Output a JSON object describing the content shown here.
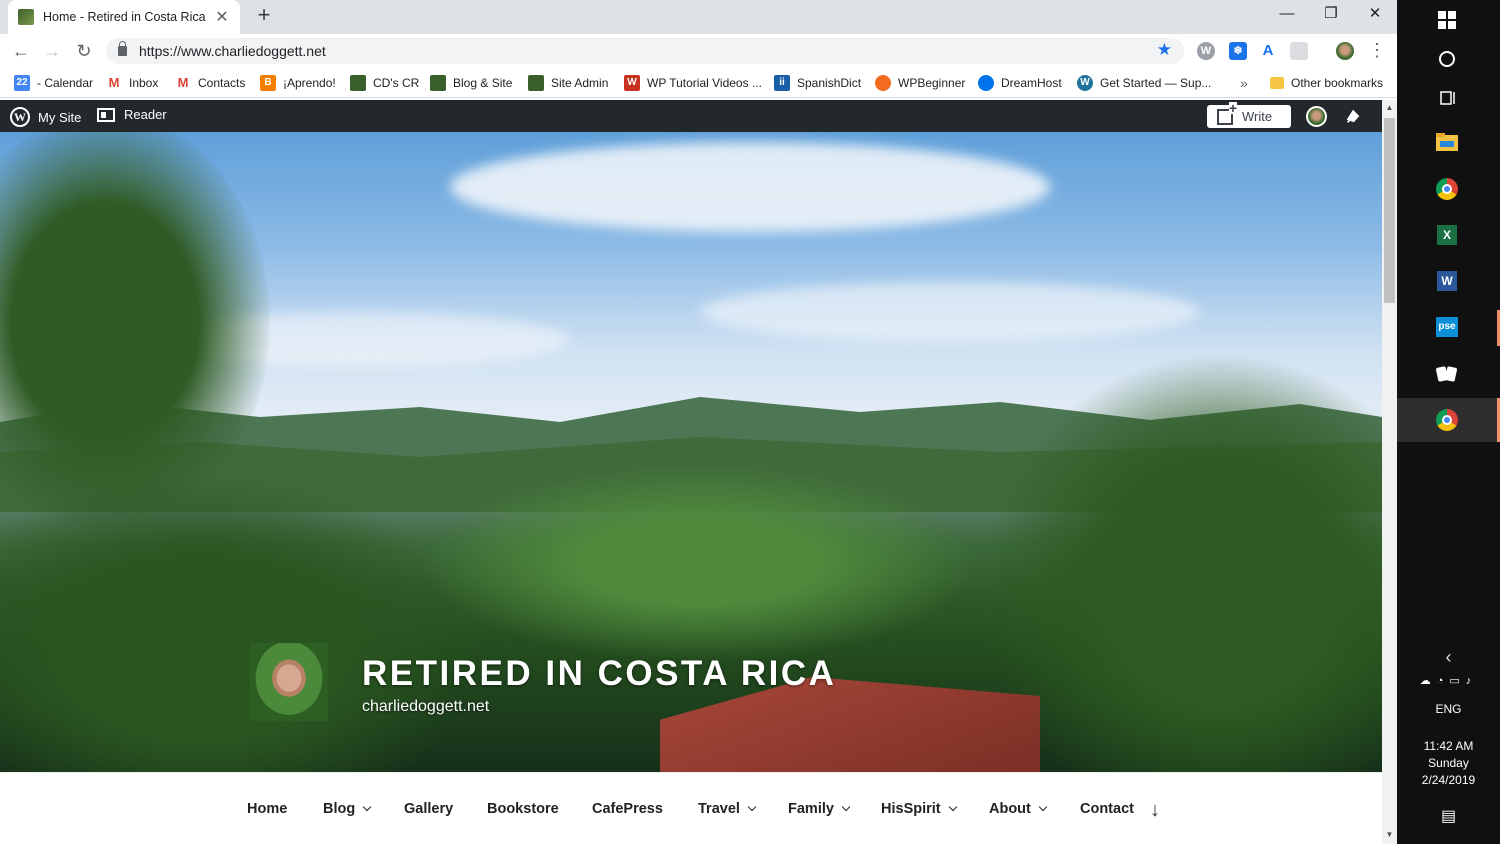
{
  "browser": {
    "tab": {
      "title": "Home - Retired in Costa Rica",
      "close_glyph": "✕"
    },
    "new_tab_glyph": "+",
    "window_controls": {
      "minimize": "—",
      "restore": "❐",
      "close": "✕"
    },
    "url": "https://www.charliedoggett.net",
    "nav": {
      "back": "←",
      "forward": "→",
      "reload": "↻"
    },
    "menu_glyph": "⋮",
    "bookmarks": [
      {
        "label": "- Calendar",
        "icon": "calendar-icon",
        "icon_text": "22",
        "color": "#4285f4"
      },
      {
        "label": "Inbox",
        "icon": "gmail-icon",
        "icon_text": "M",
        "color": "#db4437"
      },
      {
        "label": "Contacts",
        "icon": "gmail-icon",
        "icon_text": "M",
        "color": "#db4437"
      },
      {
        "label": "¡Aprendo!",
        "icon": "blogger-icon",
        "icon_text": "B",
        "color": "#f57d00"
      },
      {
        "label": "CD's CR",
        "icon": "site-icon",
        "icon_text": "",
        "color": "#3b5f2a"
      },
      {
        "label": "Blog & Site",
        "icon": "site-icon",
        "icon_text": "",
        "color": "#3b5f2a"
      },
      {
        "label": "Site Admin",
        "icon": "site-icon",
        "icon_text": "",
        "color": "#3b5f2a"
      },
      {
        "label": "WP Tutorial Videos ...",
        "icon": "video-icon",
        "icon_text": "W",
        "color": "#c8331f"
      },
      {
        "label": "SpanishDict",
        "icon": "spanishdict-icon",
        "icon_text": "ii",
        "color": "#1a5ea8"
      },
      {
        "label": "WPBeginner",
        "icon": "wpbeginner-icon",
        "icon_text": "",
        "color": "#f26b21"
      },
      {
        "label": "DreamHost",
        "icon": "dreamhost-icon",
        "icon_text": "",
        "color": "#0073ec"
      },
      {
        "label": "Get Started — Sup...",
        "icon": "wordpress-icon",
        "icon_text": "W",
        "color": "#21759b"
      }
    ],
    "bookmarks_overflow": "»",
    "other_bookmarks": "Other bookmarks"
  },
  "wp_admin_bar": {
    "my_site": "My Site",
    "reader": "Reader",
    "write": "Write",
    "wp_logo_glyph": "W"
  },
  "site": {
    "title": "RETIRED IN COSTA RICA",
    "description": "charliedoggett.net"
  },
  "nav_menu": [
    {
      "label": "Home",
      "has_dropdown": false
    },
    {
      "label": "Blog",
      "has_dropdown": true
    },
    {
      "label": "Gallery",
      "has_dropdown": false
    },
    {
      "label": "Bookstore",
      "has_dropdown": false
    },
    {
      "label": "CafePress",
      "has_dropdown": false
    },
    {
      "label": "Travel",
      "has_dropdown": true
    },
    {
      "label": "Family",
      "has_dropdown": true
    },
    {
      "label": "HisSpirit",
      "has_dropdown": true
    },
    {
      "label": "About",
      "has_dropdown": true
    },
    {
      "label": "Contact",
      "has_dropdown": false
    }
  ],
  "scroll_down_glyph": "↓",
  "taskbar": {
    "apps": [
      {
        "name": "windows-start-icon"
      },
      {
        "name": "cortana-icon"
      },
      {
        "name": "task-view-icon"
      },
      {
        "name": "file-explorer-icon"
      },
      {
        "name": "chrome-icon"
      },
      {
        "name": "excel-icon",
        "text": "X"
      },
      {
        "name": "word-icon",
        "text": "W"
      },
      {
        "name": "photoshop-elements-icon",
        "text": "pse"
      },
      {
        "name": "solitaire-icon"
      },
      {
        "name": "chrome-icon-active"
      }
    ],
    "tray_chevron": "‹",
    "language": "ENG",
    "time": "11:42 AM",
    "day": "Sunday",
    "date": "2/24/2019",
    "notification_glyph": "▤"
  }
}
